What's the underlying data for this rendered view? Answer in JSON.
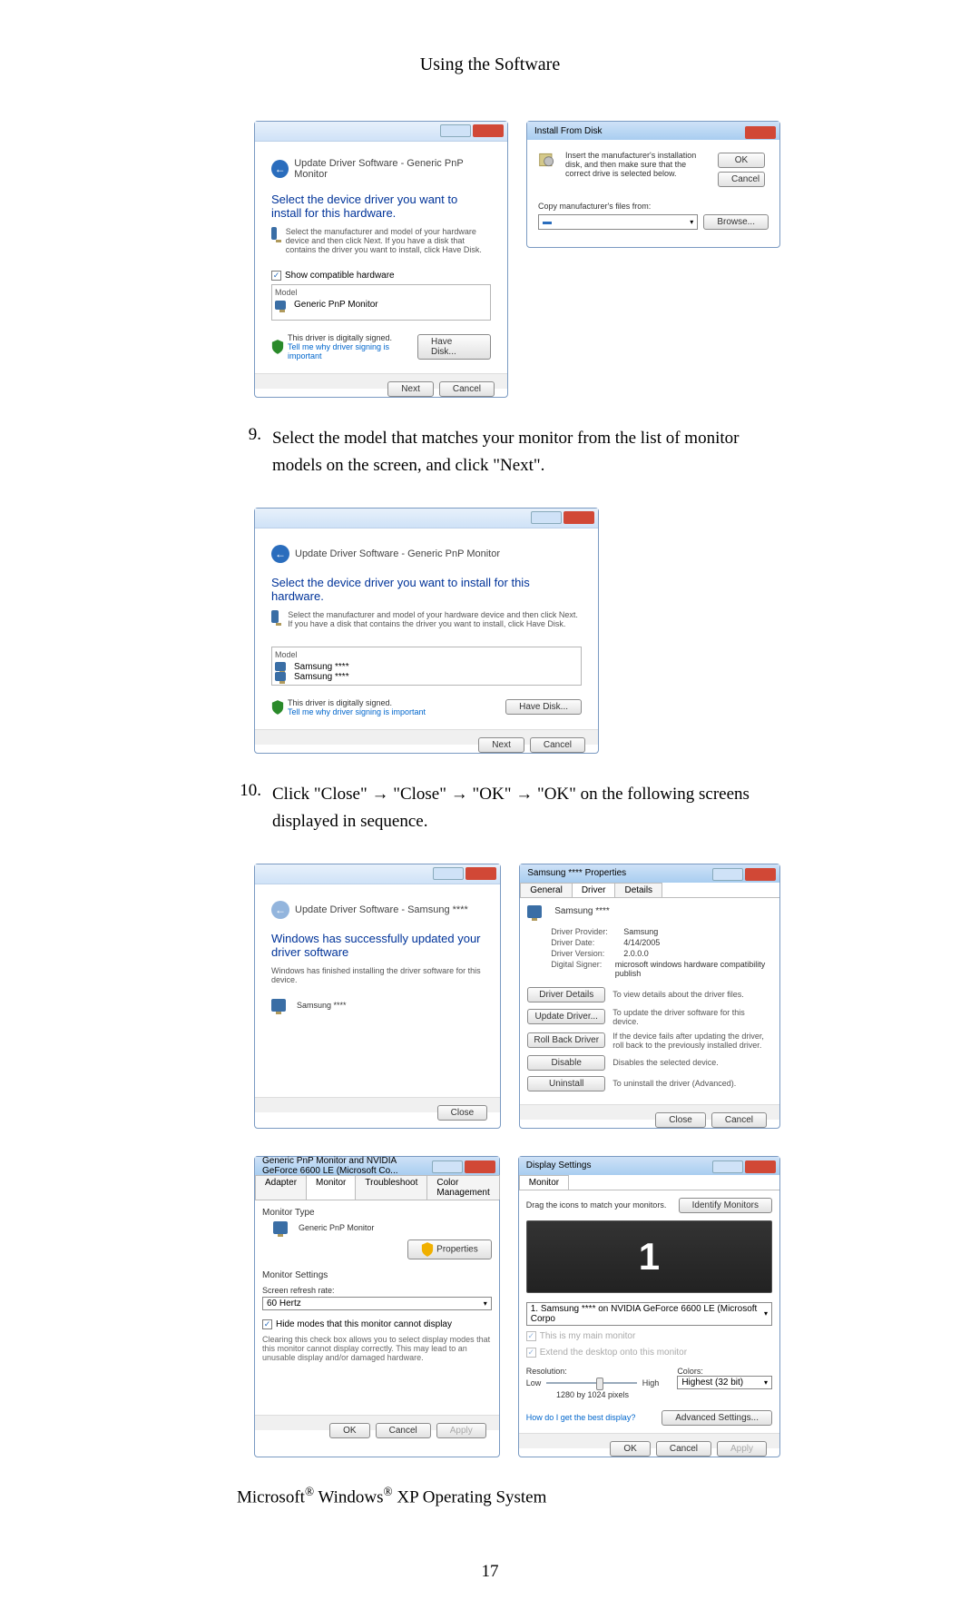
{
  "header_title": "Using the Software",
  "list9_num": "9.",
  "list9_text": "Select the model that matches your monitor from the list of monitor models on the screen, and click \"Next\".",
  "list10_num": "10.",
  "list10_text": "Click \"Close\" → \"Close\" → \"OK\" → \"OK\" on the following screens displayed in sequence.",
  "footer_pre": "Microsoft",
  "footer_mid": " Windows",
  "footer_end": " XP Operating System",
  "page_number": "17",
  "buttons": {
    "ok": "OK",
    "cancel": "Cancel",
    "next": "Next",
    "have_disk": "Have Disk...",
    "browse": "Browse...",
    "close": "Close",
    "apply": "Apply",
    "properties": "Properties",
    "driver_details": "Driver Details",
    "update_driver": "Update Driver...",
    "roll_back": "Roll Back Driver",
    "disable": "Disable",
    "uninstall": "Uninstall",
    "identify": "Identify Monitors",
    "advanced": "Advanced Settings..."
  },
  "dlg_update": {
    "breadcrumb": "Update Driver Software - Generic PnP Monitor",
    "heading": "Select the device driver you want to install for this hardware.",
    "sub": "Select the manufacturer and model of your hardware device and then click Next. If you have a disk that contains the driver you want to install, click Have Disk.",
    "show_compat": "Show compatible hardware",
    "col_model": "Model",
    "item": "Generic PnP Monitor",
    "signed": "This driver is digitally signed.",
    "why": "Tell me why driver signing is important"
  },
  "dlg_models": {
    "item1": "Samsung ****",
    "item2": "Samsung ****"
  },
  "dlg_idisk": {
    "title": "Install From Disk",
    "msg": "Insert the manufacturer's installation disk, and then make sure that the correct drive is selected below.",
    "copy": "Copy manufacturer's files from:"
  },
  "dlg_success": {
    "breadcrumb": "Update Driver Software - Samsung ****",
    "heading": "Windows has successfully updated your driver software",
    "sub": "Windows has finished installing the driver software for this device.",
    "item": "Samsung ****"
  },
  "dlg_props": {
    "title": "Samsung **** Properties",
    "tabs": {
      "general": "General",
      "driver": "Driver",
      "details": "Details"
    },
    "name": "Samsung ****",
    "rows": {
      "provider_l": "Driver Provider:",
      "provider_v": "Samsung",
      "date_l": "Driver Date:",
      "date_v": "4/14/2005",
      "version_l": "Driver Version:",
      "version_v": "2.0.0.0",
      "signer_l": "Digital Signer:",
      "signer_v": "microsoft windows hardware compatibility publish"
    },
    "desc": {
      "details": "To view details about the driver files.",
      "update": "To update the driver software for this device.",
      "rollback": "If the device fails after updating the driver, roll back to the previously installed driver.",
      "disable": "Disables the selected device.",
      "uninstall": "To uninstall the driver (Advanced)."
    }
  },
  "dlg_mon": {
    "title": "Generic PnP Monitor and NVIDIA GeForce 6600 LE (Microsoft Co...",
    "tabs": {
      "adapter": "Adapter",
      "monitor": "Monitor",
      "trouble": "Troubleshoot",
      "color": "Color Management"
    },
    "type_l": "Monitor Type",
    "type_v": "Generic PnP Monitor",
    "settings_l": "Monitor Settings",
    "refresh_l": "Screen refresh rate:",
    "refresh_v": "60 Hertz",
    "hide": "Hide modes that this monitor cannot display",
    "hide_desc": "Clearing this check box allows you to select display modes that this monitor cannot display correctly. This may lead to an unusable display and/or damaged hardware."
  },
  "dlg_display": {
    "title": "Display Settings",
    "tab": "Monitor",
    "drag": "Drag the icons to match your monitors.",
    "one": "1",
    "device": "1. Samsung **** on NVIDIA GeForce 6600 LE (Microsoft Corpo",
    "main_chk": "This is my main monitor",
    "extend_chk": "Extend the desktop onto this monitor",
    "res_l": "Resolution:",
    "colors_l": "Colors:",
    "low": "Low",
    "high": "High",
    "res_v": "1280 by 1024 pixels",
    "colors_v": "Highest (32 bit)",
    "how": "How do I get the best display?"
  }
}
